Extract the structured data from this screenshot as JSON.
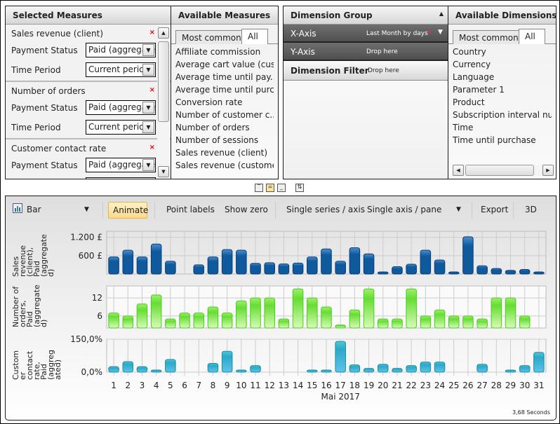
{
  "selected_measures": {
    "title": "Selected Measures",
    "items": [
      {
        "name": "Sales revenue (client)",
        "filters": [
          {
            "label": "Payment Status",
            "value": "Paid (aggregated)"
          },
          {
            "label": "Time Period",
            "value": "Current period"
          }
        ]
      },
      {
        "name": "Number of orders",
        "filters": [
          {
            "label": "Payment Status",
            "value": "Paid (aggregated)"
          },
          {
            "label": "Time Period",
            "value": "Current period"
          }
        ]
      },
      {
        "name": "Customer contact rate",
        "filters": [
          {
            "label": "Payment Status",
            "value": "Paid (aggregated)"
          }
        ]
      }
    ],
    "remove_icon": "×",
    "scroll_up": "▲",
    "scroll_down": "▼"
  },
  "available_measures": {
    "title": "Available Measures",
    "tabs": [
      "Most common",
      "All"
    ],
    "active_tab": "All",
    "items": [
      "Affiliate commission",
      "Average cart value (cus...",
      "Average time until pay...",
      "Average time until purc...",
      "Conversion rate",
      "Number of customer c...",
      "Number of orders",
      "Number of sessions",
      "Sales revenue (client)",
      "Sales revenue (customer)"
    ]
  },
  "dimension_group": {
    "title": "Dimension Group",
    "collapse_icon": "▲",
    "x_axis": {
      "label": "X-Axis",
      "value": "Last Month by days",
      "remove": "×",
      "dropdown": "▼"
    },
    "y_axis": {
      "label": "Y-Axis",
      "value": "Drop here"
    },
    "filter": {
      "label": "Dimension Filter",
      "value": "Drop here"
    }
  },
  "available_dimensions": {
    "title": "Available Dimensions",
    "tabs": [
      "Most common",
      "All"
    ],
    "active_tab": "All",
    "items": [
      "Country",
      "Currency",
      "Language",
      "Parameter 1",
      "Product",
      "Subscription interval number",
      "Time",
      "Time until purchase"
    ],
    "scroll_left": "◀",
    "scroll_right": "▶"
  },
  "layout_buttons": {
    "top": "‾",
    "middle": "=",
    "bottom": "_",
    "swap": "⇅"
  },
  "toolbar": {
    "chart_type": "Bar",
    "chart_type_arrow": "▼",
    "animate": "Animate",
    "point_labels": "Point labels",
    "show_zero": "Show zero",
    "single_series": "Single series / axis",
    "single_axis": "Single axis / pane",
    "single_axis_arrow": "▼",
    "export": "Export",
    "three_d": "3D"
  },
  "timing": "3,68 Seconds",
  "chart_data": {
    "type": "bar",
    "xlabel": "Mai 2017",
    "categories": [
      "1",
      "2",
      "3",
      "4",
      "5",
      "6",
      "7",
      "8",
      "9",
      "10",
      "11",
      "12",
      "13",
      "14",
      "15",
      "16",
      "17",
      "18",
      "19",
      "20",
      "21",
      "22",
      "23",
      "24",
      "25",
      "26",
      "27",
      "28",
      "29",
      "30",
      "31"
    ],
    "panes": [
      {
        "name": "Sales revenue (client), Paid (aggregated)",
        "ylabel": "Sales\nrevenue\n(client),\nPaid\n(aggregate\nd)",
        "ticks": [
          "1.200 £",
          "600 £"
        ],
        "tick_values": [
          1200,
          600
        ],
        "ylim": [
          0,
          1400
        ],
        "color": "#0e5a9c",
        "values": [
          560,
          780,
          560,
          980,
          420,
          0,
          300,
          560,
          800,
          780,
          350,
          370,
          330,
          360,
          560,
          820,
          420,
          860,
          660,
          40,
          240,
          320,
          780,
          460,
          60,
          1220,
          270,
          180,
          120,
          150,
          50
        ]
      },
      {
        "name": "Number of orders, Paid (aggregated)",
        "ylabel": "Number of\norders,\nPaid\n(aggregate\nd)",
        "ticks": [
          "12",
          "6"
        ],
        "tick_values": [
          12,
          6
        ],
        "ylim": [
          2,
          16
        ],
        "color": "#66dd33",
        "values": [
          7,
          6,
          10,
          13,
          5,
          7,
          7,
          9,
          7,
          11,
          12,
          12,
          5,
          15,
          12,
          9,
          3,
          8,
          15,
          5,
          5,
          15,
          6,
          8,
          6,
          6,
          5,
          12,
          12,
          6,
          0
        ]
      },
      {
        "name": "Customer contact rate, Paid (aggregated)",
        "ylabel": "Custom\ner\ncontact\nrate,\nPaid\n(aggreg\nated)",
        "ticks": [
          "150,0%",
          "0,0%"
        ],
        "tick_values": [
          150,
          0
        ],
        "ylim": [
          0,
          150
        ],
        "color": "#2ba9c8",
        "values": [
          25,
          48,
          25,
          5,
          58,
          0,
          0,
          40,
          95,
          7,
          30,
          0,
          0,
          0,
          5,
          8,
          140,
          33,
          17,
          36,
          17,
          30,
          46,
          46,
          0,
          0,
          36,
          0,
          5,
          30,
          90
        ]
      }
    ]
  }
}
